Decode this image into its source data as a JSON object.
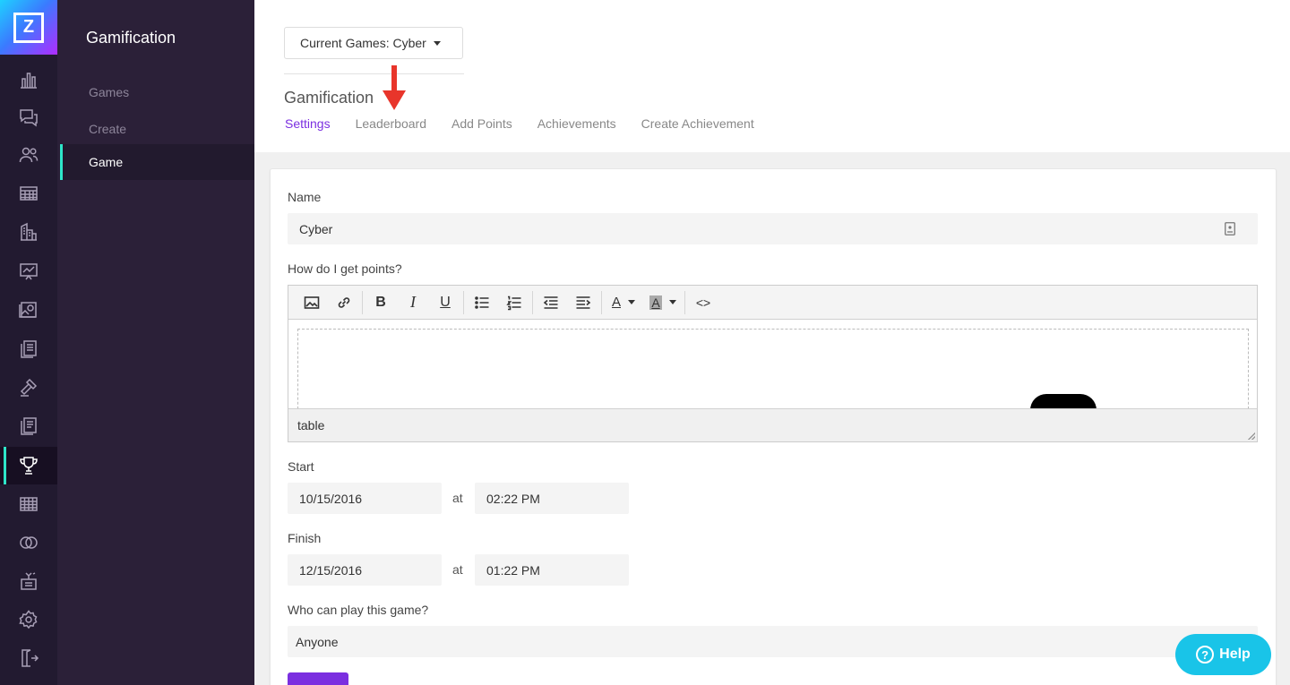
{
  "app": {
    "logo_letter": "Z",
    "accent_color": "#7b2fe0",
    "rail_active_color": "#2ee6c9"
  },
  "rail": {
    "items": [
      {
        "icon": "bar-chart-icon"
      },
      {
        "icon": "chat-icon"
      },
      {
        "icon": "users-icon"
      },
      {
        "icon": "table-icon"
      },
      {
        "icon": "buildings-icon"
      },
      {
        "icon": "presentation-icon"
      },
      {
        "icon": "gallery-icon"
      },
      {
        "icon": "documents-icon"
      },
      {
        "icon": "gavel-icon"
      },
      {
        "icon": "notes-icon"
      },
      {
        "icon": "trophy-icon",
        "active": true
      },
      {
        "icon": "grid-icon"
      },
      {
        "icon": "rings-icon"
      },
      {
        "icon": "broadcast-icon"
      },
      {
        "icon": "gear-icon"
      },
      {
        "icon": "logout-icon"
      }
    ]
  },
  "subnav": {
    "title": "Gamification",
    "items": [
      {
        "label": "Games"
      },
      {
        "label": "Create"
      },
      {
        "label": "Game",
        "active": true
      }
    ]
  },
  "header": {
    "games_dropdown": "Current Games: Cyber",
    "title": "Gamification",
    "tabs": [
      {
        "label": "Settings",
        "active": true
      },
      {
        "label": "Leaderboard"
      },
      {
        "label": "Add Points"
      },
      {
        "label": "Achievements"
      },
      {
        "label": "Create Achievement"
      }
    ]
  },
  "form": {
    "name_label": "Name",
    "name_value": "Cyber",
    "points_label": "How do I get points?",
    "editor_status": "table",
    "start_label": "Start",
    "start_date": "10/15/2016",
    "start_time": "02:22 PM",
    "finish_label": "Finish",
    "finish_date": "12/15/2016",
    "finish_time": "01:22 PM",
    "at_label": "at",
    "who_label": "Who can play this game?",
    "who_value": "Anyone"
  },
  "help": {
    "label": "Help",
    "color": "#19c4e8"
  }
}
